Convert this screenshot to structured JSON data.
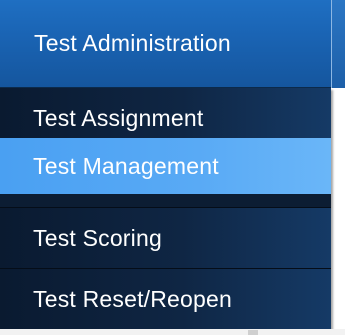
{
  "menu": {
    "title": "Test Administration",
    "items": [
      {
        "label": "Test Assignment",
        "state": "normal"
      },
      {
        "label": "Test Management",
        "state": "hovered"
      },
      {
        "label": "Test Scoring",
        "state": "normal"
      },
      {
        "label": "Test Reset/Reopen",
        "state": "normal"
      }
    ]
  },
  "colors": {
    "top_bar": "#1a64b4",
    "dropdown_bg": "#0c1d33",
    "highlight": "#59aaf5",
    "text": "#ffffff"
  }
}
